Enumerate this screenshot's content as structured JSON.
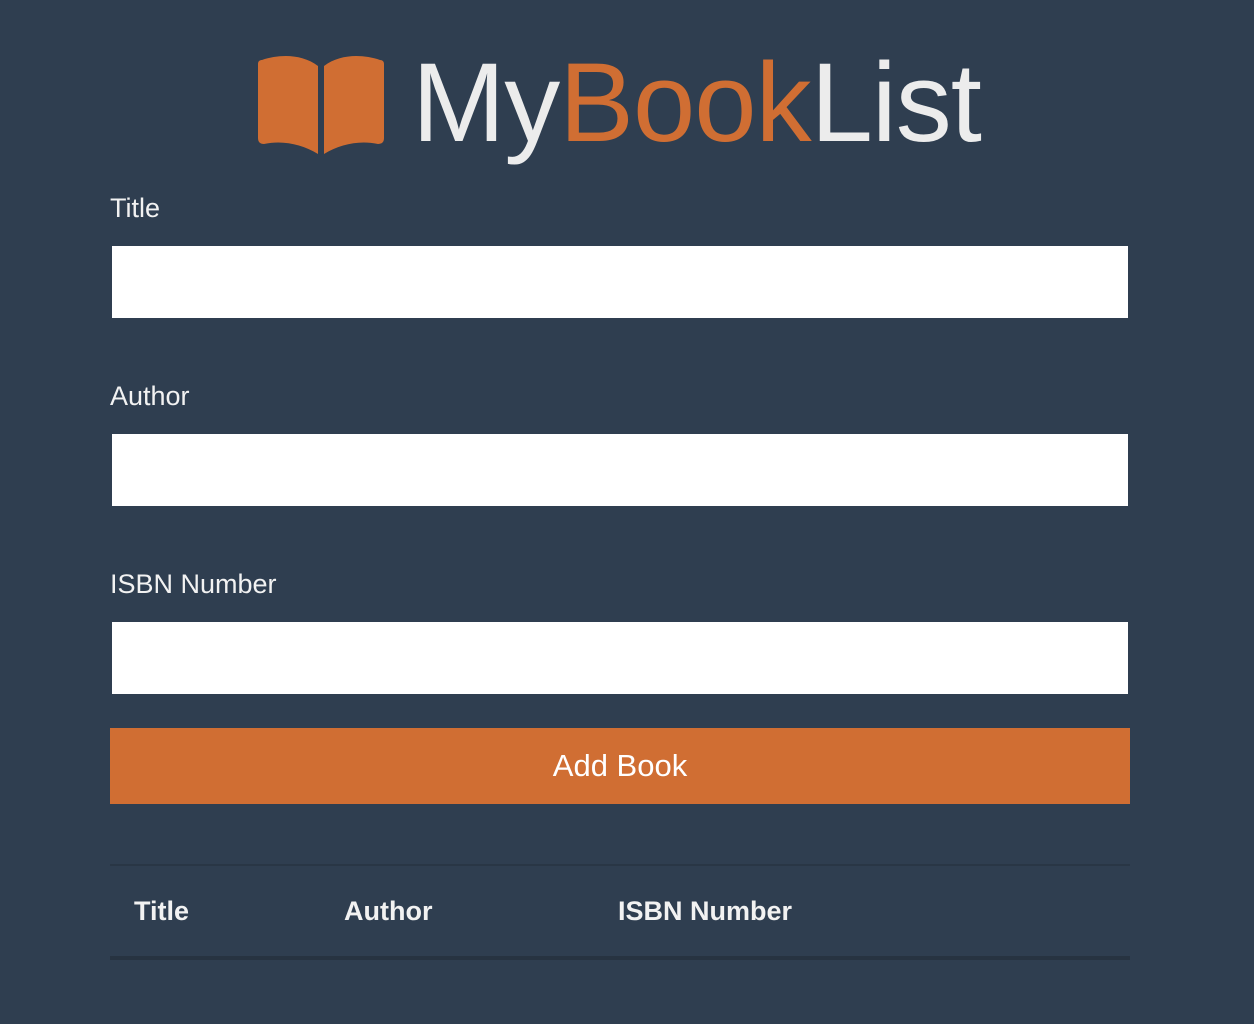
{
  "app": {
    "logo": {
      "part1": "My",
      "part2": "Book",
      "part3": "List",
      "icon": "open-book-icon",
      "accent_color": "#d06e33"
    }
  },
  "form": {
    "fields": [
      {
        "label": "Title",
        "value": "",
        "placeholder": ""
      },
      {
        "label": "Author",
        "value": "",
        "placeholder": ""
      },
      {
        "label": "ISBN Number",
        "value": "",
        "placeholder": ""
      }
    ],
    "submit_label": "Add Book"
  },
  "table": {
    "headers": [
      "Title",
      "Author",
      "ISBN Number"
    ],
    "rows": []
  },
  "colors": {
    "background": "#2f3e50",
    "accent": "#d06e33",
    "text": "#f2f2f2"
  }
}
